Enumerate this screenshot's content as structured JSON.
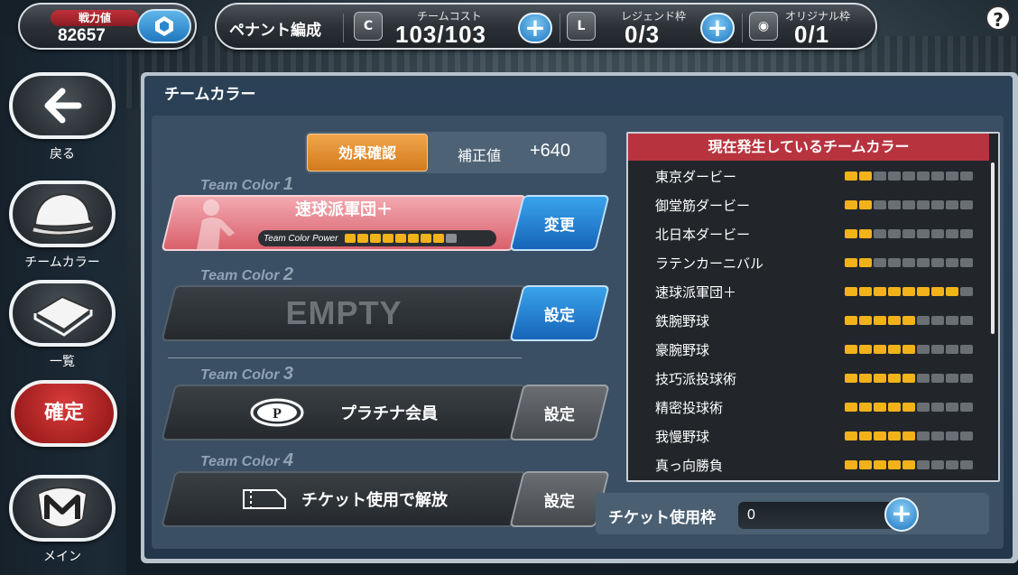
{
  "status": {
    "power_label": "戦力値",
    "power_value": "82657",
    "pennant_title": "ペナント編成",
    "team_cost_label": "チームコスト",
    "team_cost_value": "103/103",
    "legend_label": "レジェンド枠",
    "legend_value": "0/3",
    "original_label": "オリジナル枠",
    "original_value": "0/1",
    "help": "?"
  },
  "nav": {
    "back": "戻る",
    "team_color": "チームカラー",
    "list": "一覧",
    "confirm": "確定",
    "main": "メイン"
  },
  "panel": {
    "title": "チームカラー",
    "effect_button": "効果確認",
    "modifier_label": "補正値",
    "modifier_value": "+640"
  },
  "slots": [
    {
      "header": "Team Color",
      "num": "1",
      "name": "速球派軍団＋",
      "power_label": "Team Color Power",
      "power_level": 8,
      "power_max": 9,
      "button": "変更"
    },
    {
      "header": "Team Color",
      "num": "2",
      "name": "EMPTY",
      "button": "設定"
    },
    {
      "header": "Team Color",
      "num": "3",
      "name": "プラチナ会員",
      "button": "設定"
    },
    {
      "header": "Team Color",
      "num": "4",
      "name": "チケット使用で解放",
      "button": "設定"
    }
  ],
  "ticket": {
    "label": "チケット使用枠",
    "value": "0"
  },
  "current_list": {
    "header": "現在発生しているチームカラー",
    "items": [
      {
        "name": "東京ダービー",
        "level": 2,
        "max": 9
      },
      {
        "name": "御堂筋ダービー",
        "level": 2,
        "max": 9
      },
      {
        "name": "北日本ダービー",
        "level": 2,
        "max": 9
      },
      {
        "name": "ラテンカーニバル",
        "level": 2,
        "max": 9
      },
      {
        "name": "速球派軍団＋",
        "level": 8,
        "max": 9
      },
      {
        "name": "鉄腕野球",
        "level": 5,
        "max": 9
      },
      {
        "name": "豪腕野球",
        "level": 5,
        "max": 9
      },
      {
        "name": "技巧派投球術",
        "level": 5,
        "max": 9
      },
      {
        "name": "精密投球術",
        "level": 5,
        "max": 9
      },
      {
        "name": "我慢野球",
        "level": 5,
        "max": 9
      },
      {
        "name": "真っ向勝負",
        "level": 5,
        "max": 9
      }
    ]
  },
  "colors": {
    "accent_red": "#b7343f",
    "accent_blue": "#1f78bf",
    "accent_orange": "#f2b21a"
  }
}
